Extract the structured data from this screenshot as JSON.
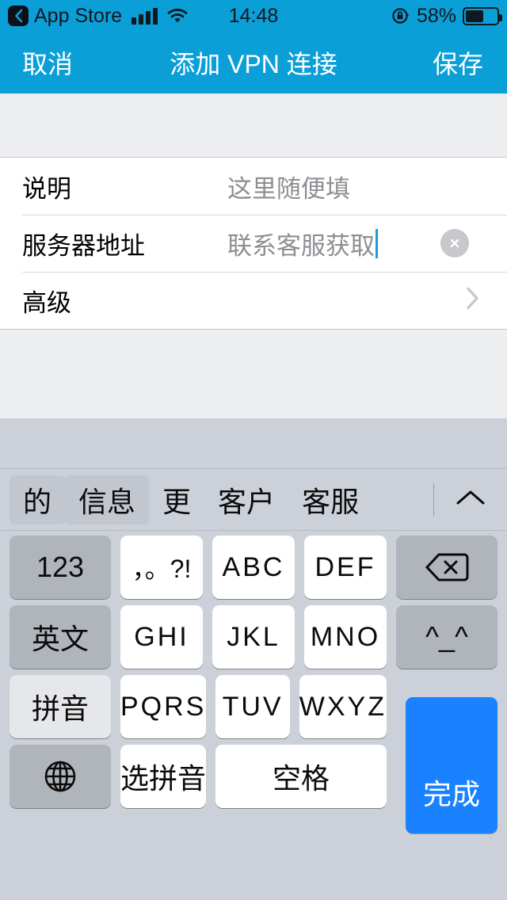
{
  "status_bar": {
    "back_app": "App Store",
    "back_icon": "chevron-left-icon",
    "signal_icon": "cellular-signal-icon",
    "wifi_icon": "wifi-icon",
    "time": "14:48",
    "rotation_lock_icon": "rotation-lock-icon",
    "battery_percent": "58%",
    "battery_level": 58
  },
  "nav_bar": {
    "cancel_label": "取消",
    "title": "添加 VPN 连接",
    "save_label": "保存"
  },
  "form": {
    "rows": [
      {
        "label": "说明",
        "value": "这里随便填",
        "state": "placeholder"
      },
      {
        "label": "服务器地址",
        "value": "联系客服获取",
        "state": "editing"
      },
      {
        "label": "高级",
        "value": "",
        "state": "disclosure"
      }
    ],
    "clear_icon": "clear-text-icon",
    "disclosure_icon": "chevron-right-icon"
  },
  "keyboard": {
    "candidates": [
      "的",
      "信息",
      "更",
      "客户",
      "客服"
    ],
    "expand_icon": "chevron-up-icon",
    "rows": [
      [
        {
          "label": "123",
          "style": "gray",
          "name": "key-123"
        },
        {
          "label": "，。?!",
          "style": "white",
          "name": "key-punctuation"
        },
        {
          "label": "ABC",
          "style": "white",
          "name": "key-abc"
        },
        {
          "label": "DEF",
          "style": "white",
          "name": "key-def"
        },
        {
          "label": "",
          "style": "gray",
          "name": "key-backspace",
          "icon": "backspace-icon"
        }
      ],
      [
        {
          "label": "英文",
          "style": "gray",
          "name": "key-english"
        },
        {
          "label": "GHI",
          "style": "white",
          "name": "key-ghi"
        },
        {
          "label": "JKL",
          "style": "white",
          "name": "key-jkl"
        },
        {
          "label": "MNO",
          "style": "white",
          "name": "key-mno"
        },
        {
          "label": "^_^",
          "style": "gray",
          "name": "key-emoticon"
        }
      ],
      [
        {
          "label": "拼音",
          "style": "lightgray",
          "name": "key-pinyin"
        },
        {
          "label": "PQRS",
          "style": "white",
          "name": "key-pqrs"
        },
        {
          "label": "TUV",
          "style": "white",
          "name": "key-tuv"
        },
        {
          "label": "WXYZ",
          "style": "white",
          "name": "key-wxyz"
        }
      ],
      [
        {
          "label": "",
          "style": "gray",
          "name": "key-globe",
          "icon": "globe-icon"
        },
        {
          "label": "选拼音",
          "style": "white",
          "name": "key-select-pinyin"
        },
        {
          "label": "空格",
          "style": "white",
          "name": "key-space"
        }
      ]
    ],
    "done_label": "完成"
  },
  "colors": {
    "accent": "#0b9fd8",
    "done_key": "#1a82ff",
    "keyboard_bg": "#ccd1d9",
    "caret": "#1b9ae0"
  }
}
